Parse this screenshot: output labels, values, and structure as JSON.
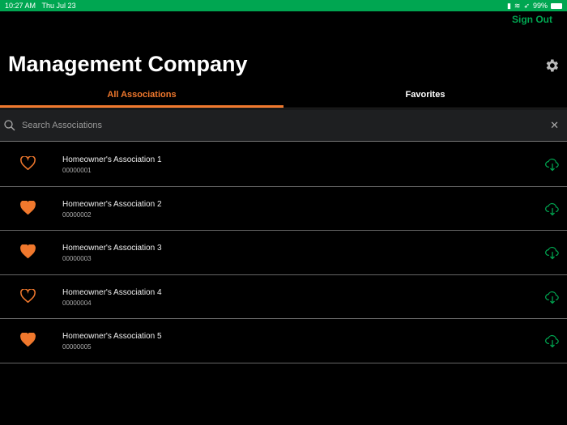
{
  "status": {
    "time": "10:27 AM",
    "date": "Thu Jul 23",
    "battery": "99%"
  },
  "header": {
    "sign_out": "Sign Out",
    "title": "Management Company"
  },
  "tabs": [
    {
      "label": "All Associations"
    },
    {
      "label": "Favorites"
    }
  ],
  "search": {
    "placeholder": "Search Associations",
    "value": ""
  },
  "colors": {
    "accent": "#f0782d",
    "green": "#00a651"
  },
  "associations": [
    {
      "name": "Homeowner's Association 1",
      "id": "00000001",
      "favorite": false
    },
    {
      "name": "Homeowner's Association 2",
      "id": "00000002",
      "favorite": true
    },
    {
      "name": "Homeowner's Association 3",
      "id": "00000003",
      "favorite": true
    },
    {
      "name": "Homeowner's Association 4",
      "id": "00000004",
      "favorite": false
    },
    {
      "name": "Homeowner's Association 5",
      "id": "00000005",
      "favorite": true
    }
  ]
}
